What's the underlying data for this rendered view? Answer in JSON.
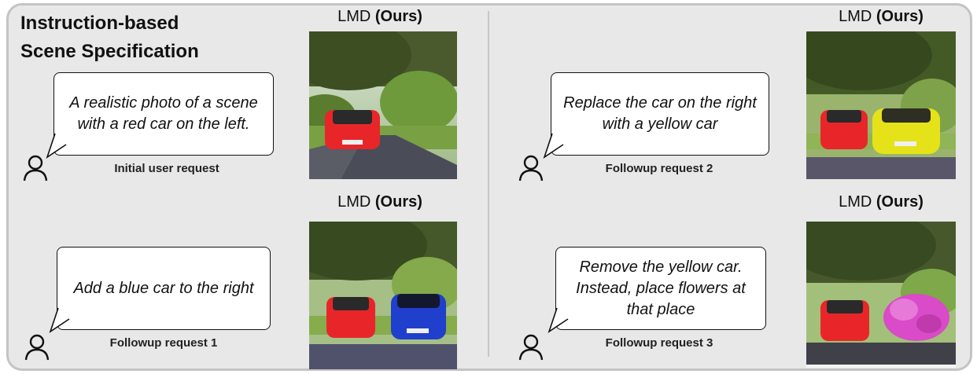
{
  "title_line1": "Instruction-based",
  "title_line2": "Scene Specification",
  "method_label": "LMD",
  "method_suffix": "(Ours)",
  "steps": [
    {
      "request": "A realistic photo of a scene with a red car on the left.",
      "caption": "Initial user request"
    },
    {
      "request": "Replace the car on the right with a yellow car",
      "caption": "Followup request 2"
    },
    {
      "request": "Add a blue car to the right",
      "caption": "Followup request 1"
    },
    {
      "request": "Remove the yellow car. Instead, place flowers at that place",
      "caption": "Followup request 3"
    }
  ],
  "colors": {
    "panel": "#e8e8e8",
    "red_car": "#e8262a",
    "yellow_car": "#e6e21a",
    "blue_car": "#1f3fcc",
    "flowers": "#d94bc8"
  }
}
